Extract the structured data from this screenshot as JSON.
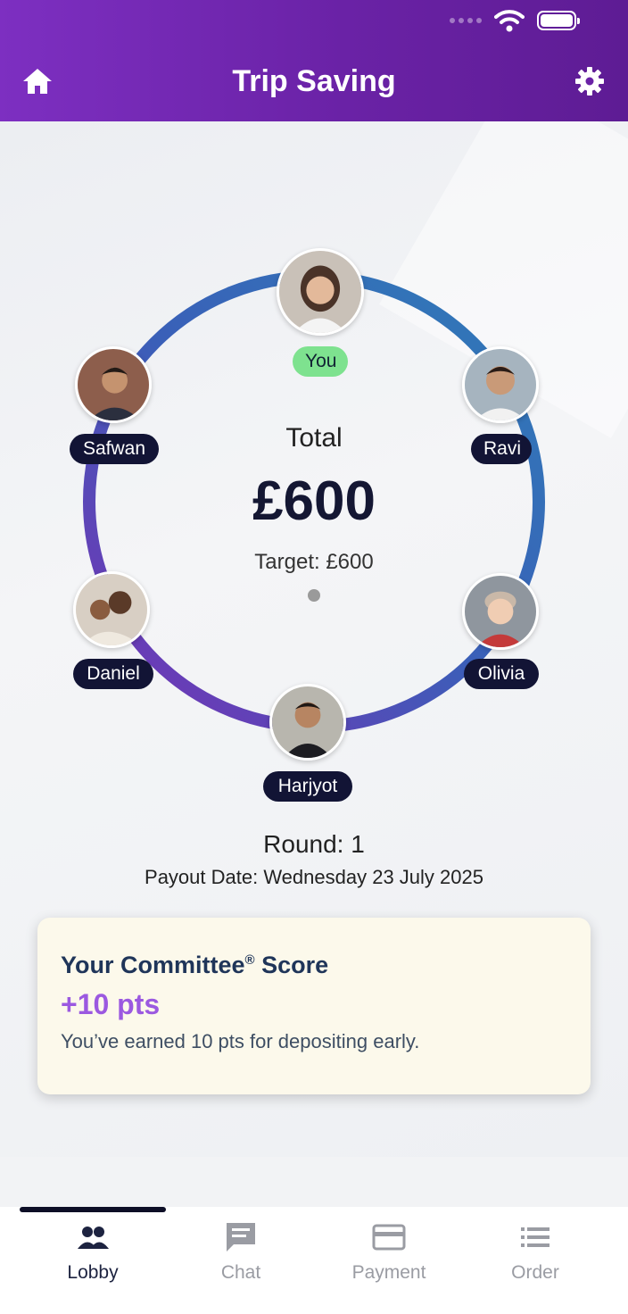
{
  "header": {
    "title": "Trip Saving",
    "home_icon": "home-icon",
    "settings_icon": "gear-icon"
  },
  "status_bar": {
    "icons": [
      "signal-dots-icon",
      "wifi-icon",
      "battery-icon"
    ]
  },
  "pot": {
    "total_label": "Total",
    "total_amount": "£600",
    "target": "Target: £600"
  },
  "members": [
    {
      "name": "You",
      "badge_color": "#7ee28f"
    },
    {
      "name": "Ravi"
    },
    {
      "name": "Olivia"
    },
    {
      "name": "Harjyot"
    },
    {
      "name": "Daniel"
    },
    {
      "name": "Safwan"
    }
  ],
  "round": {
    "label": "Round: 1",
    "payout_date": "Payout Date: Wednesday 23 July 2025"
  },
  "score_card": {
    "title": "Your Committee",
    "title_mark": "®",
    "title_suffix": " Score",
    "points": "+10 pts",
    "message": "You’ve earned 10 pts for depositing early."
  },
  "nav": {
    "active": "Lobby",
    "items": [
      {
        "label": "Lobby",
        "icon": "people-icon"
      },
      {
        "label": "Chat",
        "icon": "chat-icon"
      },
      {
        "label": "Payment",
        "icon": "card-icon"
      },
      {
        "label": "Order",
        "icon": "list-icon"
      }
    ]
  },
  "colors": {
    "header": "#6a22a6",
    "ring_start": "#2f7db8",
    "ring_end": "#7a2fb6",
    "accent_points": "#9b59e0",
    "label_bg": "#121435"
  }
}
